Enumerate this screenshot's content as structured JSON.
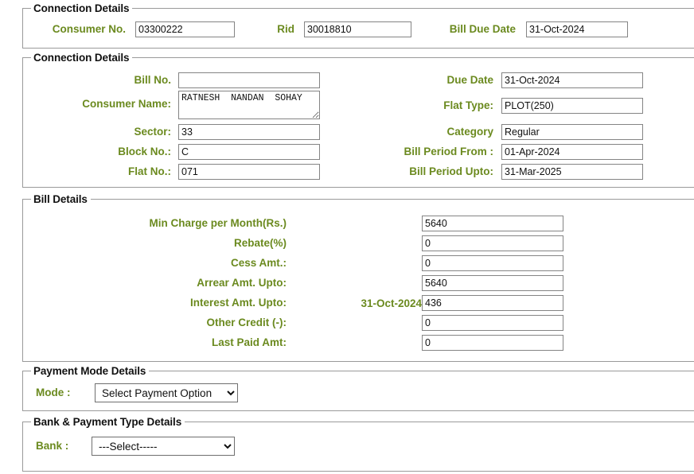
{
  "sections": {
    "connection_top": {
      "legend": "Connection Details",
      "fields": {
        "consumer_no": {
          "label": "Consumer No.",
          "value": "03300222"
        },
        "rid": {
          "label": "Rid",
          "value": "30018810"
        },
        "bill_due_date": {
          "label": "Bill Due Date",
          "value": "31-Oct-2024"
        }
      }
    },
    "connection_details": {
      "legend": "Connection Details",
      "left": {
        "bill_no": {
          "label": "Bill No.",
          "value": ""
        },
        "consumer_name": {
          "label": "Consumer Name:",
          "value": "RATNESH  NANDAN  SOHAY"
        },
        "sector": {
          "label": "Sector:",
          "value": "33"
        },
        "block_no": {
          "label": "Block No.:",
          "value": "C"
        },
        "flat_no": {
          "label": "Flat No.:",
          "value": "071"
        }
      },
      "right": {
        "due_date": {
          "label": "Due Date",
          "value": "31-Oct-2024"
        },
        "flat_type": {
          "label": "Flat Type:",
          "value": "PLOT(250)"
        },
        "category": {
          "label": "Category",
          "value": "Regular"
        },
        "bill_period_from": {
          "label": "Bill Period From :",
          "value": "01-Apr-2024"
        },
        "bill_period_upto": {
          "label": "Bill Period Upto:",
          "value": "31-Mar-2025"
        }
      }
    },
    "bill_details": {
      "legend": "Bill Details",
      "rows": [
        {
          "label": "Min Charge per Month(Rs.)",
          "mid": "",
          "value": "5640"
        },
        {
          "label": "Rebate(%)",
          "mid": "",
          "value": "0"
        },
        {
          "label": "Cess Amt.:",
          "mid": "",
          "value": "0"
        },
        {
          "label": "Arrear Amt. Upto:",
          "mid": "",
          "value": "5640"
        },
        {
          "label": "Interest Amt. Upto:",
          "mid": "31-Oct-2024",
          "value": "436"
        },
        {
          "label": "Other Credit (-):",
          "mid": "",
          "value": "0"
        },
        {
          "label": "Last Paid Amt:",
          "mid": "",
          "value": "0"
        }
      ]
    },
    "payment_mode": {
      "legend": "Payment Mode Details",
      "mode": {
        "label": "Mode :",
        "selected": "Select Payment Option",
        "options": [
          "Select Payment Option"
        ]
      }
    },
    "bank_type": {
      "legend": "Bank & Payment Type Details",
      "bank": {
        "label": "Bank :",
        "selected": "---Select-----",
        "options": [
          "---Select-----"
        ]
      }
    }
  },
  "colors": {
    "label_green": "#6b8a1f",
    "border_gray": "#9a9a9a",
    "input_border": "#848484"
  }
}
